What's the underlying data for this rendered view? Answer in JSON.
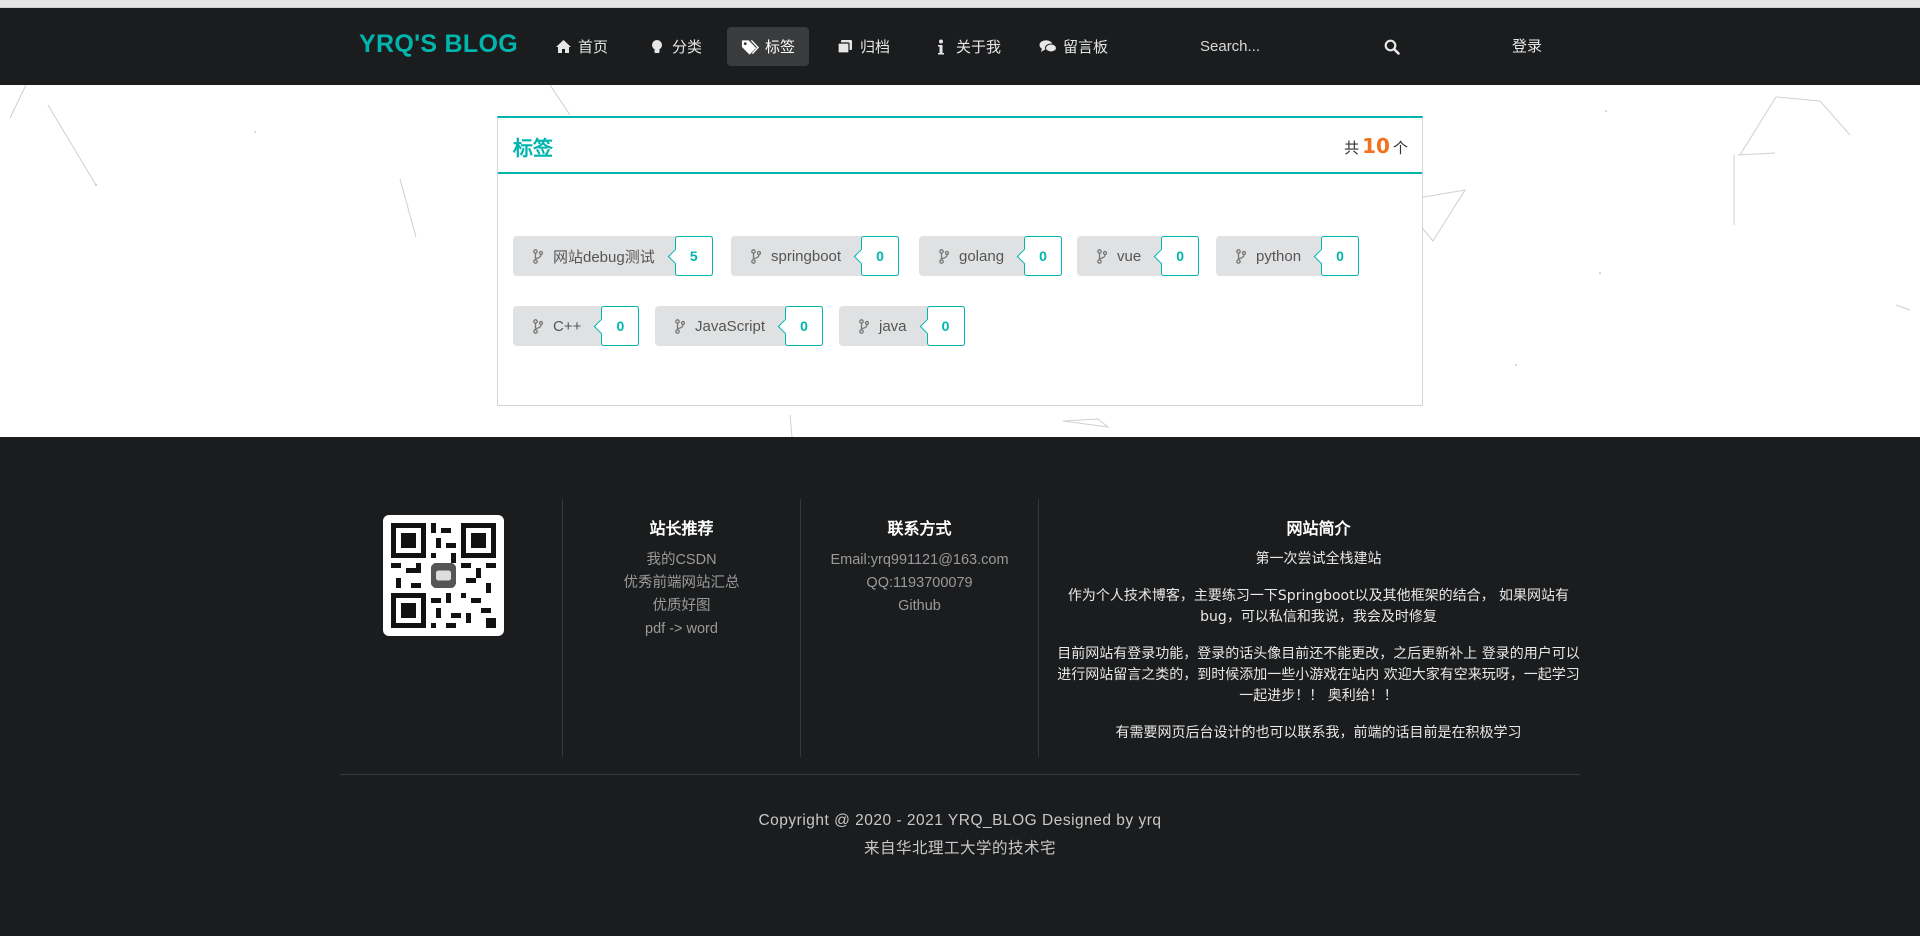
{
  "nav": {
    "brand": "YRQ'S BLOG",
    "items": [
      {
        "label": "首页",
        "icon": "home-icon"
      },
      {
        "label": "分类",
        "icon": "lightbulb-icon"
      },
      {
        "label": "标签",
        "icon": "tags-icon",
        "active": true
      },
      {
        "label": "归档",
        "icon": "clone-icon"
      },
      {
        "label": "关于我",
        "icon": "info-icon"
      },
      {
        "label": "留言板",
        "icon": "comments-icon"
      }
    ],
    "search_placeholder": "Search...",
    "login": "登录"
  },
  "tags_panel": {
    "title": "标签",
    "count_prefix": "共",
    "count": "10",
    "count_suffix": "个",
    "tags": [
      {
        "name": "网站debug测试",
        "count": "5"
      },
      {
        "name": "springboot",
        "count": "0"
      },
      {
        "name": "golang",
        "count": "0"
      },
      {
        "name": "vue",
        "count": "0"
      },
      {
        "name": "python",
        "count": "0"
      },
      {
        "name": "C++",
        "count": "0"
      },
      {
        "name": "JavaScript",
        "count": "0"
      },
      {
        "name": "java",
        "count": "0"
      }
    ]
  },
  "footer": {
    "recommend": {
      "title": "站长推荐",
      "links": [
        "我的CSDN",
        "优秀前端网站汇总",
        "优质好图",
        "pdf -> word"
      ]
    },
    "contact": {
      "title": "联系方式",
      "links": [
        "Email:yrq991121@163.com",
        "QQ:1193700079",
        "Github"
      ]
    },
    "about": {
      "title": "网站简介",
      "paragraphs": [
        "第一次尝试全栈建站",
        "作为个人技术博客，主要练习一下Springboot以及其他框架的结合， 如果网站有bug，可以私信和我说，我会及时修复",
        "目前网站有登录功能，登录的话头像目前还不能更改，之后更新补上 登录的用户可以进行网站留言之类的，到时候添加一些小游戏在站内 欢迎大家有空来玩呀，一起学习一起进步！！ 奥利给！！",
        "有需要网页后台设计的也可以联系我，前端的话目前是在积极学习"
      ]
    },
    "copyright": "Copyright @ 2020 - 2021 YRQ_BLOG Designed by yrq",
    "origin": "来自华北理工大学的技术宅"
  },
  "colors": {
    "accent": "#00b5ad",
    "count_orange": "#f2711c",
    "dark": "#1b1c1d"
  }
}
